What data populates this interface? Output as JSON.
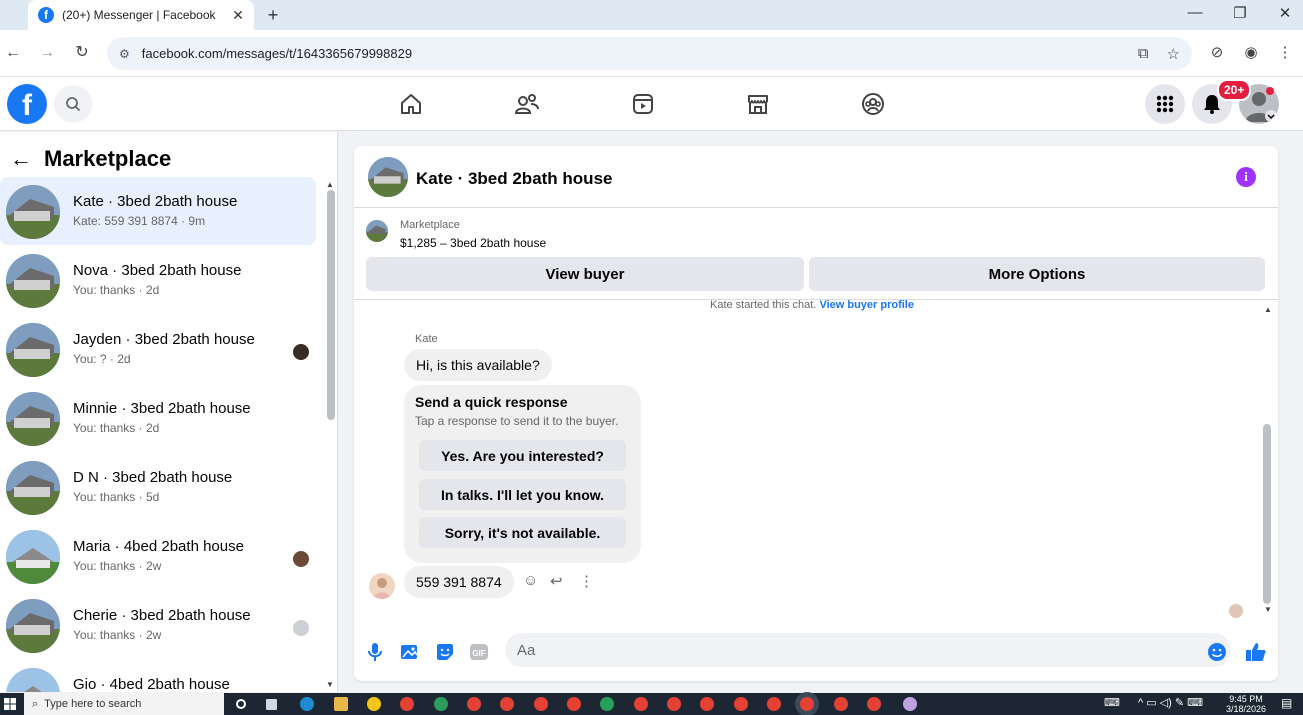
{
  "browser": {
    "tab_title": "(20+) Messenger | Facebook",
    "url": "facebook.com/messages/t/1643365679998829"
  },
  "fb": {
    "logo": "f",
    "notification_badge": "20+"
  },
  "sidebar": {
    "title": "Marketplace",
    "conversations": [
      {
        "name": "Kate · 3bed 2bath house",
        "preview": "Kate: 559 391 8874 · 9m",
        "active": true
      },
      {
        "name": "Nova · 3bed 2bath house",
        "preview": "You: thanks · 2d"
      },
      {
        "name": "Jayden · 3bed 2bath house",
        "preview": "You: ? · 2d"
      },
      {
        "name": "Minnie · 3bed 2bath house",
        "preview": "You: thanks · 2d"
      },
      {
        "name": "D N · 3bed 2bath house",
        "preview": "You: thanks · 5d"
      },
      {
        "name": "Maria · 4bed 2bath house",
        "preview": "You: thanks · 2w"
      },
      {
        "name": "Cherie · 3bed 2bath house",
        "preview": "You: thanks · 2w"
      },
      {
        "name": "Gio · 4bed 2bath house",
        "preview": ""
      }
    ]
  },
  "chat": {
    "title": "Kate · 3bed 2bath house",
    "marketplace_label": "Marketplace",
    "listing": "$1,285 – 3bed 2bath house",
    "view_buyer": "View buyer",
    "more_options": "More Options",
    "started_text": "Kate started this chat.",
    "view_buyer_profile": "View buyer profile",
    "sender": "Kate",
    "first_message": "Hi, is this available?",
    "quick_title": "Send a quick response",
    "quick_subtitle": "Tap a response to send it to the buyer.",
    "quick_responses": [
      "Yes. Are you interested?",
      "In talks. I'll let you know.",
      "Sorry, it's not available."
    ],
    "last_message": "559 391 8874",
    "composer_placeholder": "Aa"
  },
  "taskbar": {
    "search_placeholder": "Type here to search",
    "time": "9:45 PM",
    "date": "3/18/2026"
  },
  "colors": {
    "brand": "#1877f2",
    "badge": "#e41e3f",
    "info": "#a033ff"
  }
}
